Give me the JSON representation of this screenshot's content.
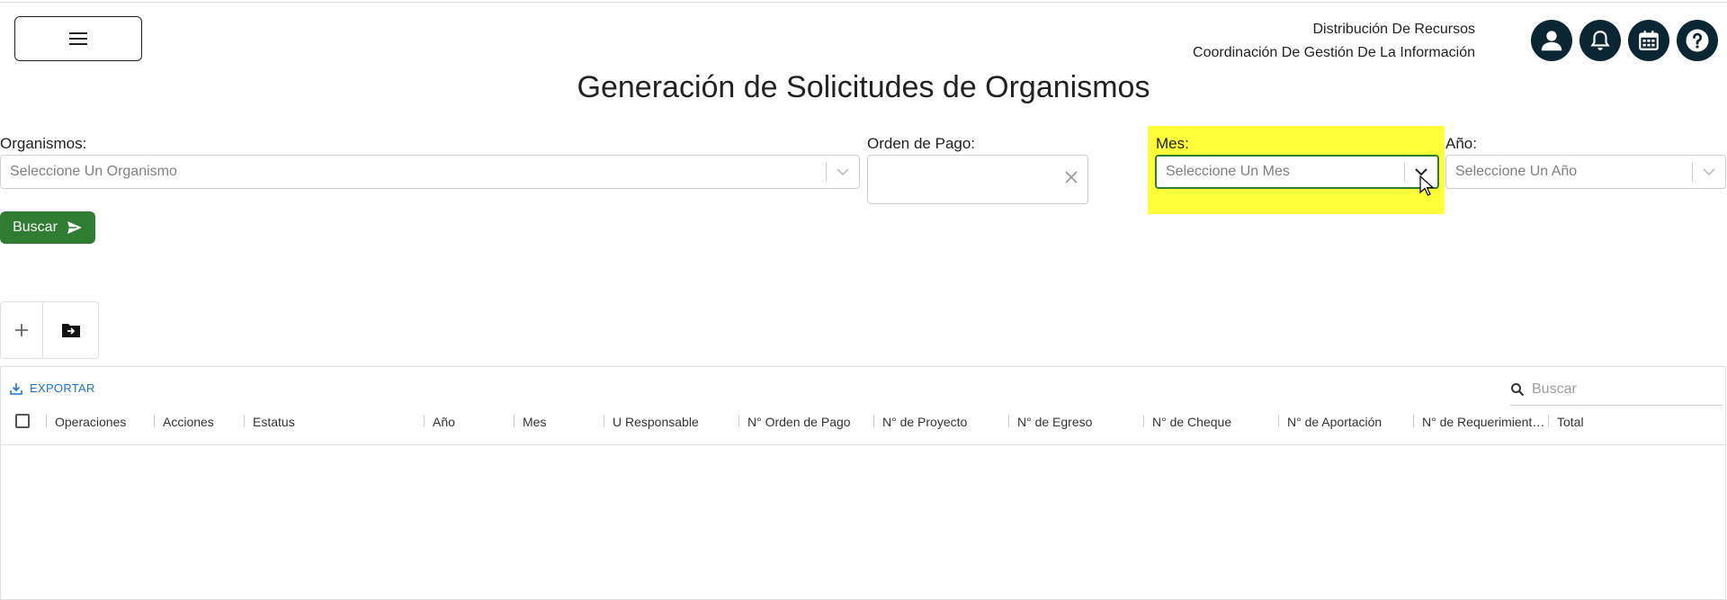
{
  "header": {
    "line1": "Distribución De Recursos",
    "line2": "Coordinación De Gestión De La Información",
    "icons": [
      "user-icon",
      "bell-icon",
      "calendar-icon",
      "help-icon"
    ]
  },
  "page": {
    "title": "Generación de Solicitudes de Organismos"
  },
  "filters": {
    "organismos": {
      "label": "Organismos:",
      "placeholder": "Seleccione Un Organismo"
    },
    "orden": {
      "label": "Orden de Pago:",
      "value": ""
    },
    "mes": {
      "label": "Mes:",
      "placeholder": "Seleccione Un Mes"
    },
    "anio": {
      "label": "Año:",
      "placeholder": "Seleccione Un Año"
    },
    "search_button": "Buscar"
  },
  "grid": {
    "export_label": "EXPORTAR",
    "search_placeholder": "Buscar",
    "columns": [
      "Operaciones",
      "Acciones",
      "Estatus",
      "Año",
      "Mes",
      "U Responsable",
      "N° Orden de Pago",
      "N° de Proyecto",
      "N° de Egreso",
      "N° de Cheque",
      "N° de Aportación",
      "N° de Requerimient…",
      "Total"
    ]
  },
  "colors": {
    "button_green": "#2e7d32",
    "highlight": "#ffff3a",
    "icon_dark": "#0a2633",
    "link_blue": "#1976d2"
  }
}
